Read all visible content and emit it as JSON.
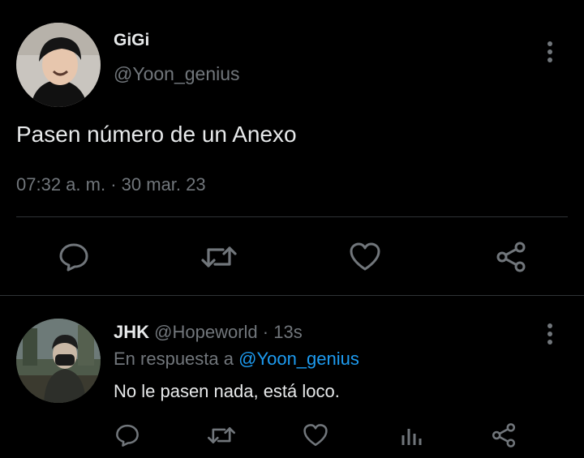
{
  "main_tweet": {
    "display_name": "GiGi",
    "handle": "@Yoon_genius",
    "text": "Pasen número de un Anexo",
    "time": "07:32 a. m.",
    "separator": "·",
    "date": "30 mar. 23"
  },
  "reply_tweet": {
    "display_name": "JHK",
    "handle": "@Hopeworld",
    "separator": "·",
    "age": "13s",
    "reply_prefix": "En respuesta a",
    "reply_to": "@Yoon_genius",
    "text": "No le pasen nada, está loco."
  },
  "icons": {
    "more": "more-vertical-icon",
    "reply": "reply-icon",
    "retweet": "retweet-icon",
    "like": "heart-icon",
    "share": "share-icon",
    "analytics": "analytics-icon"
  },
  "colors": {
    "background": "#000000",
    "text": "#e7e9ea",
    "muted": "#71767b",
    "link": "#1d9bf0",
    "divider": "#2f3336"
  }
}
